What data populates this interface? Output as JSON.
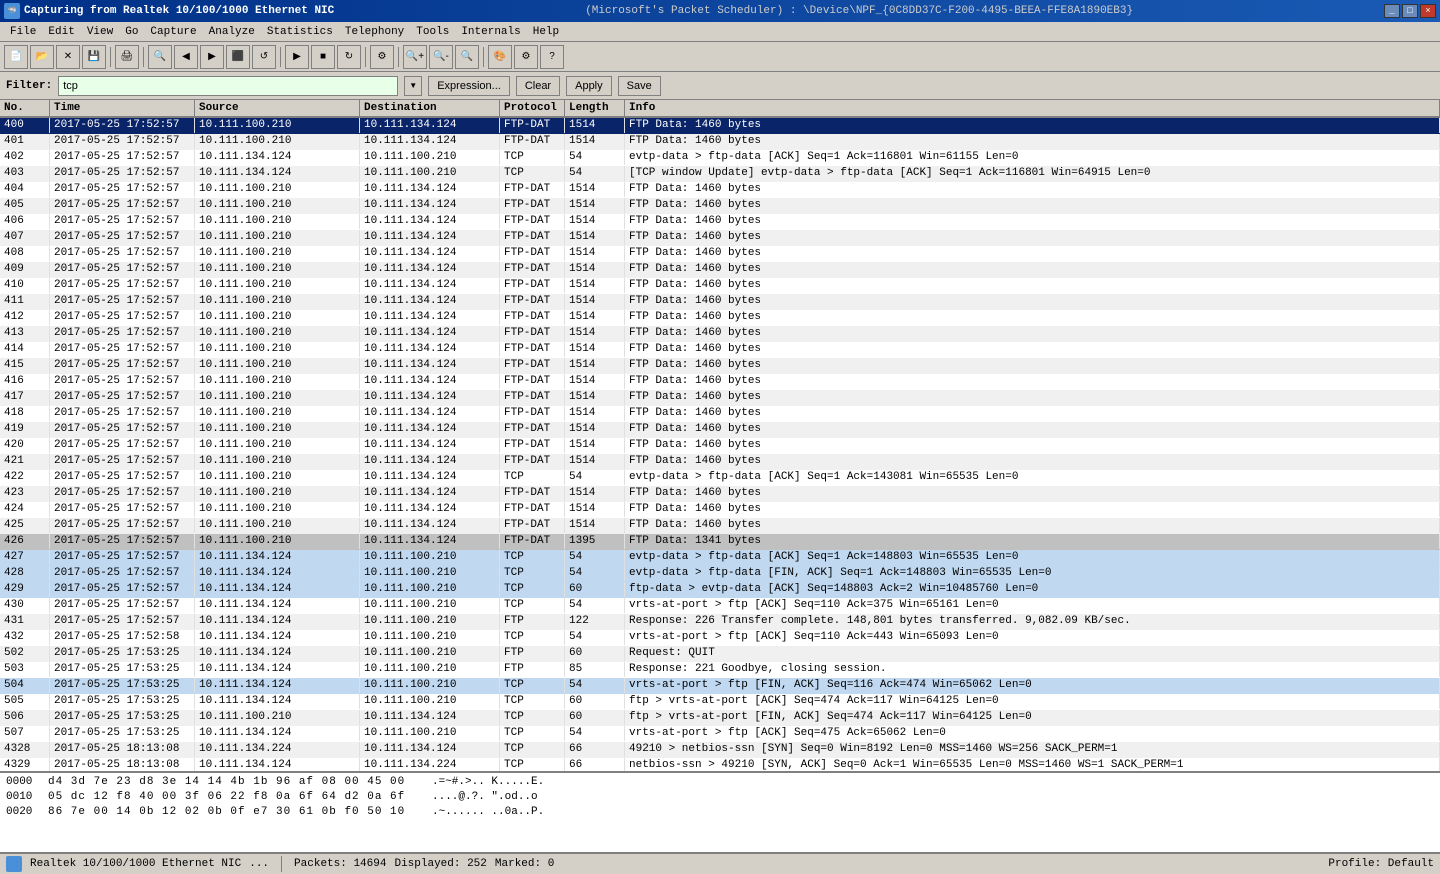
{
  "titleBar": {
    "left": "Capturing from Realtek 10/100/1000 Ethernet NIC",
    "right": "(Microsoft's Packet Scheduler) : \\Device\\NPF_{0C8DD37C-F200-4495-BEEA-FFE8A1890EB3}",
    "controls": [
      "_",
      "□",
      "×"
    ]
  },
  "menuBar": {
    "items": [
      "File",
      "Edit",
      "View",
      "Go",
      "Capture",
      "Analyze",
      "Statistics",
      "Telephony",
      "Tools",
      "Internals",
      "Help"
    ]
  },
  "filterBar": {
    "label": "Filter:",
    "value": "tcp",
    "buttons": [
      "Expression...",
      "Clear",
      "Apply",
      "Save"
    ]
  },
  "columns": [
    "No.",
    "Time",
    "Source",
    "Destination",
    "Protocol",
    "Length",
    "Info"
  ],
  "packets": [
    {
      "no": "400",
      "time": "2017-05-25 17:52:57",
      "src": "10.111.100.210",
      "dst": "10.111.134.124",
      "proto": "FTP-DAT",
      "len": "1514",
      "info": "FTP Data: 1460 bytes",
      "style": "selected"
    },
    {
      "no": "401",
      "time": "2017-05-25 17:52:57",
      "src": "10.111.100.210",
      "dst": "10.111.134.124",
      "proto": "FTP-DAT",
      "len": "1514",
      "info": "FTP Data: 1460 bytes",
      "style": ""
    },
    {
      "no": "402",
      "time": "2017-05-25 17:52:57",
      "src": "10.111.134.124",
      "dst": "10.111.100.210",
      "proto": "TCP",
      "len": "54",
      "info": "evtp-data > ftp-data [ACK] Seq=1 Ack=116801 Win=61155 Len=0",
      "style": ""
    },
    {
      "no": "403",
      "time": "2017-05-25 17:52:57",
      "src": "10.111.134.124",
      "dst": "10.111.100.210",
      "proto": "TCP",
      "len": "54",
      "info": "[TCP window Update] evtp-data > ftp-data [ACK] Seq=1 Ack=116801 Win=64915 Len=0",
      "style": ""
    },
    {
      "no": "404",
      "time": "2017-05-25 17:52:57",
      "src": "10.111.100.210",
      "dst": "10.111.134.124",
      "proto": "FTP-DAT",
      "len": "1514",
      "info": "FTP Data: 1460 bytes",
      "style": ""
    },
    {
      "no": "405",
      "time": "2017-05-25 17:52:57",
      "src": "10.111.100.210",
      "dst": "10.111.134.124",
      "proto": "FTP-DAT",
      "len": "1514",
      "info": "FTP Data: 1460 bytes",
      "style": ""
    },
    {
      "no": "406",
      "time": "2017-05-25 17:52:57",
      "src": "10.111.100.210",
      "dst": "10.111.134.124",
      "proto": "FTP-DAT",
      "len": "1514",
      "info": "FTP Data: 1460 bytes",
      "style": ""
    },
    {
      "no": "407",
      "time": "2017-05-25 17:52:57",
      "src": "10.111.100.210",
      "dst": "10.111.134.124",
      "proto": "FTP-DAT",
      "len": "1514",
      "info": "FTP Data: 1460 bytes",
      "style": ""
    },
    {
      "no": "408",
      "time": "2017-05-25 17:52:57",
      "src": "10.111.100.210",
      "dst": "10.111.134.124",
      "proto": "FTP-DAT",
      "len": "1514",
      "info": "FTP Data: 1460 bytes",
      "style": ""
    },
    {
      "no": "409",
      "time": "2017-05-25 17:52:57",
      "src": "10.111.100.210",
      "dst": "10.111.134.124",
      "proto": "FTP-DAT",
      "len": "1514",
      "info": "FTP Data: 1460 bytes",
      "style": ""
    },
    {
      "no": "410",
      "time": "2017-05-25 17:52:57",
      "src": "10.111.100.210",
      "dst": "10.111.134.124",
      "proto": "FTP-DAT",
      "len": "1514",
      "info": "FTP Data: 1460 bytes",
      "style": ""
    },
    {
      "no": "411",
      "time": "2017-05-25 17:52:57",
      "src": "10.111.100.210",
      "dst": "10.111.134.124",
      "proto": "FTP-DAT",
      "len": "1514",
      "info": "FTP Data: 1460 bytes",
      "style": ""
    },
    {
      "no": "412",
      "time": "2017-05-25 17:52:57",
      "src": "10.111.100.210",
      "dst": "10.111.134.124",
      "proto": "FTP-DAT",
      "len": "1514",
      "info": "FTP Data: 1460 bytes",
      "style": ""
    },
    {
      "no": "413",
      "time": "2017-05-25 17:52:57",
      "src": "10.111.100.210",
      "dst": "10.111.134.124",
      "proto": "FTP-DAT",
      "len": "1514",
      "info": "FTP Data: 1460 bytes",
      "style": ""
    },
    {
      "no": "414",
      "time": "2017-05-25 17:52:57",
      "src": "10.111.100.210",
      "dst": "10.111.134.124",
      "proto": "FTP-DAT",
      "len": "1514",
      "info": "FTP Data: 1460 bytes",
      "style": ""
    },
    {
      "no": "415",
      "time": "2017-05-25 17:52:57",
      "src": "10.111.100.210",
      "dst": "10.111.134.124",
      "proto": "FTP-DAT",
      "len": "1514",
      "info": "FTP Data: 1460 bytes",
      "style": ""
    },
    {
      "no": "416",
      "time": "2017-05-25 17:52:57",
      "src": "10.111.100.210",
      "dst": "10.111.134.124",
      "proto": "FTP-DAT",
      "len": "1514",
      "info": "FTP Data: 1460 bytes",
      "style": ""
    },
    {
      "no": "417",
      "time": "2017-05-25 17:52:57",
      "src": "10.111.100.210",
      "dst": "10.111.134.124",
      "proto": "FTP-DAT",
      "len": "1514",
      "info": "FTP Data: 1460 bytes",
      "style": ""
    },
    {
      "no": "418",
      "time": "2017-05-25 17:52:57",
      "src": "10.111.100.210",
      "dst": "10.111.134.124",
      "proto": "FTP-DAT",
      "len": "1514",
      "info": "FTP Data: 1460 bytes",
      "style": ""
    },
    {
      "no": "419",
      "time": "2017-05-25 17:52:57",
      "src": "10.111.100.210",
      "dst": "10.111.134.124",
      "proto": "FTP-DAT",
      "len": "1514",
      "info": "FTP Data: 1460 bytes",
      "style": ""
    },
    {
      "no": "420",
      "time": "2017-05-25 17:52:57",
      "src": "10.111.100.210",
      "dst": "10.111.134.124",
      "proto": "FTP-DAT",
      "len": "1514",
      "info": "FTP Data: 1460 bytes",
      "style": ""
    },
    {
      "no": "421",
      "time": "2017-05-25 17:52:57",
      "src": "10.111.100.210",
      "dst": "10.111.134.124",
      "proto": "FTP-DAT",
      "len": "1514",
      "info": "FTP Data: 1460 bytes",
      "style": ""
    },
    {
      "no": "422",
      "time": "2017-05-25 17:52:57",
      "src": "10.111.100.210",
      "dst": "10.111.134.124",
      "proto": "TCP",
      "len": "54",
      "info": "evtp-data > ftp-data [ACK] Seq=1 Ack=143081 Win=65535 Len=0",
      "style": ""
    },
    {
      "no": "423",
      "time": "2017-05-25 17:52:57",
      "src": "10.111.100.210",
      "dst": "10.111.134.124",
      "proto": "FTP-DAT",
      "len": "1514",
      "info": "FTP Data: 1460 bytes",
      "style": ""
    },
    {
      "no": "424",
      "time": "2017-05-25 17:52:57",
      "src": "10.111.100.210",
      "dst": "10.111.134.124",
      "proto": "FTP-DAT",
      "len": "1514",
      "info": "FTP Data: 1460 bytes",
      "style": ""
    },
    {
      "no": "425",
      "time": "2017-05-25 17:52:57",
      "src": "10.111.100.210",
      "dst": "10.111.134.124",
      "proto": "FTP-DAT",
      "len": "1514",
      "info": "FTP Data: 1460 bytes",
      "style": ""
    },
    {
      "no": "426",
      "time": "2017-05-25 17:52:57",
      "src": "10.111.100.210",
      "dst": "10.111.134.124",
      "proto": "FTP-DAT",
      "len": "1395",
      "info": "FTP Data: 1341 bytes",
      "style": "grey"
    },
    {
      "no": "427",
      "time": "2017-05-25 17:52:57",
      "src": "10.111.134.124",
      "dst": "10.111.100.210",
      "proto": "TCP",
      "len": "54",
      "info": "evtp-data > ftp-data [ACK] Seq=1 Ack=148803 Win=65535 Len=0",
      "style": "light-blue"
    },
    {
      "no": "428",
      "time": "2017-05-25 17:52:57",
      "src": "10.111.134.124",
      "dst": "10.111.100.210",
      "proto": "TCP",
      "len": "54",
      "info": "evtp-data > ftp-data [FIN, ACK] Seq=1 Ack=148803 Win=65535 Len=0",
      "style": "light-blue"
    },
    {
      "no": "429",
      "time": "2017-05-25 17:52:57",
      "src": "10.111.134.124",
      "dst": "10.111.100.210",
      "proto": "TCP",
      "len": "60",
      "info": "ftp-data > evtp-data [ACK] Seq=148803 Ack=2 Win=10485760 Len=0",
      "style": "light-blue"
    },
    {
      "no": "430",
      "time": "2017-05-25 17:52:57",
      "src": "10.111.134.124",
      "dst": "10.111.100.210",
      "proto": "TCP",
      "len": "54",
      "info": "vrts-at-port > ftp [ACK] Seq=110 Ack=375 Win=65161 Len=0",
      "style": ""
    },
    {
      "no": "431",
      "time": "2017-05-25 17:52:57",
      "src": "10.111.134.124",
      "dst": "10.111.100.210",
      "proto": "FTP",
      "len": "122",
      "info": "Response: 226 Transfer complete. 148,801 bytes transferred. 9,082.09 KB/sec.",
      "style": ""
    },
    {
      "no": "432",
      "time": "2017-05-25 17:52:58",
      "src": "10.111.134.124",
      "dst": "10.111.100.210",
      "proto": "TCP",
      "len": "54",
      "info": "vrts-at-port > ftp [ACK] Seq=110 Ack=443 Win=65093 Len=0",
      "style": ""
    },
    {
      "no": "502",
      "time": "2017-05-25 17:53:25",
      "src": "10.111.134.124",
      "dst": "10.111.100.210",
      "proto": "FTP",
      "len": "60",
      "info": "Request: QUIT",
      "style": ""
    },
    {
      "no": "503",
      "time": "2017-05-25 17:53:25",
      "src": "10.111.134.124",
      "dst": "10.111.100.210",
      "proto": "FTP",
      "len": "85",
      "info": "Response: 221 Goodbye, closing session.",
      "style": ""
    },
    {
      "no": "504",
      "time": "2017-05-25 17:53:25",
      "src": "10.111.134.124",
      "dst": "10.111.100.210",
      "proto": "TCP",
      "len": "54",
      "info": "vrts-at-port > ftp [FIN, ACK] Seq=116 Ack=474 Win=65062 Len=0",
      "style": "light-blue"
    },
    {
      "no": "505",
      "time": "2017-05-25 17:53:25",
      "src": "10.111.134.124",
      "dst": "10.111.100.210",
      "proto": "TCP",
      "len": "60",
      "info": "ftp > vrts-at-port [ACK] Seq=474 Ack=117 Win=64125 Len=0",
      "style": ""
    },
    {
      "no": "506",
      "time": "2017-05-25 17:53:25",
      "src": "10.111.100.210",
      "dst": "10.111.134.124",
      "proto": "TCP",
      "len": "60",
      "info": "ftp > vrts-at-port [FIN, ACK] Seq=474 Ack=117 Win=64125 Len=0",
      "style": ""
    },
    {
      "no": "507",
      "time": "2017-05-25 17:53:25",
      "src": "10.111.134.124",
      "dst": "10.111.100.210",
      "proto": "TCP",
      "len": "54",
      "info": "vrts-at-port > ftp [ACK] Seq=475 Ack=65062 Len=0",
      "style": ""
    },
    {
      "no": "4328",
      "time": "2017-05-25 18:13:08",
      "src": "10.111.134.224",
      "dst": "10.111.134.124",
      "proto": "TCP",
      "len": "66",
      "info": "49210 > netbios-ssn [SYN] Seq=0 Win=8192 Len=0 MSS=1460 WS=256 SACK_PERM=1",
      "style": ""
    },
    {
      "no": "4329",
      "time": "2017-05-25 18:13:08",
      "src": "10.111.134.124",
      "dst": "10.111.134.224",
      "proto": "TCP",
      "len": "66",
      "info": "netbios-ssn > 49210 [SYN, ACK] Seq=0 Ack=1 Win=65535 Len=0 MSS=1460 WS=1 SACK_PERM=1",
      "style": ""
    }
  ],
  "hexRows": [
    {
      "offset": "0000",
      "bytes": "d4 3d 7e 23 d8 3e 14 14  4b 1b 96 af 08 00 45 00",
      "ascii": ".=~#.>..  K.....E."
    },
    {
      "offset": "0010",
      "bytes": "05 dc 12 f8 40 00 3f 06  22 f8 0a 6f 64 d2 0a 6f",
      "ascii": "....@.?. \".od..o"
    },
    {
      "offset": "0020",
      "bytes": "86 7e 00 14 0b 12 02 0b  0f e7 30 61 0b f0 50 10",
      "ascii": ".~...... ..0a..P."
    }
  ],
  "statusBar": {
    "nic": "Realtek 10/100/1000 Ethernet NIC",
    "ellipsis": "...",
    "packets": "Packets: 14694",
    "displayed": "Displayed: 252",
    "marked": "Marked: 0",
    "profile": "Profile: Default"
  }
}
